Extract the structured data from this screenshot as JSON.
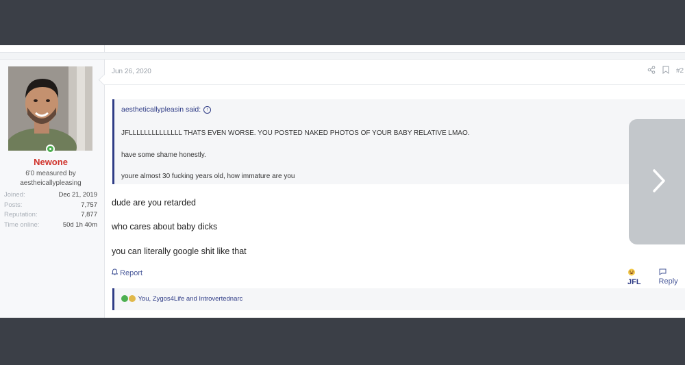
{
  "post": {
    "date": "Jun 26, 2020",
    "post_number": "#2",
    "author": {
      "username": "Newone",
      "title_line1": "6'0 measured by",
      "title_line2": "aestheicallypleasing",
      "stats": [
        {
          "label": "Joined:",
          "value": "Dec 21, 2019"
        },
        {
          "label": "Posts:",
          "value": "7,757"
        },
        {
          "label": "Reputation:",
          "value": "7,877"
        },
        {
          "label": "Time online:",
          "value": "50d 1h 40m"
        }
      ]
    },
    "quote": {
      "author_said": "aestheticallypleasin said:",
      "lines": [
        "JFLLLLLLLLLLLLLL THATS EVEN WORSE. YOU POSTED NAKED PHOTOS OF YOUR BABY RELATIVE LMAO.",
        "have some shame honestly.",
        "youre almost 30 fucking years old, how immature are you"
      ]
    },
    "message_lines": [
      "dude are you retarded",
      "who cares about baby dicks",
      "you can literally google shit like that"
    ],
    "actions": {
      "report": "Report",
      "jfl": "JFL",
      "reply": "Reply"
    },
    "reactions_text": "You, Zygos4Life and Introvertednarc"
  },
  "icons": [
    "share-icon",
    "bookmark-icon",
    "bell-icon",
    "reply-icon",
    "chevron-right-icon"
  ],
  "colors": {
    "username": "#d0342c",
    "accent": "#2f3c86",
    "background_frame": "#3b3f47"
  }
}
